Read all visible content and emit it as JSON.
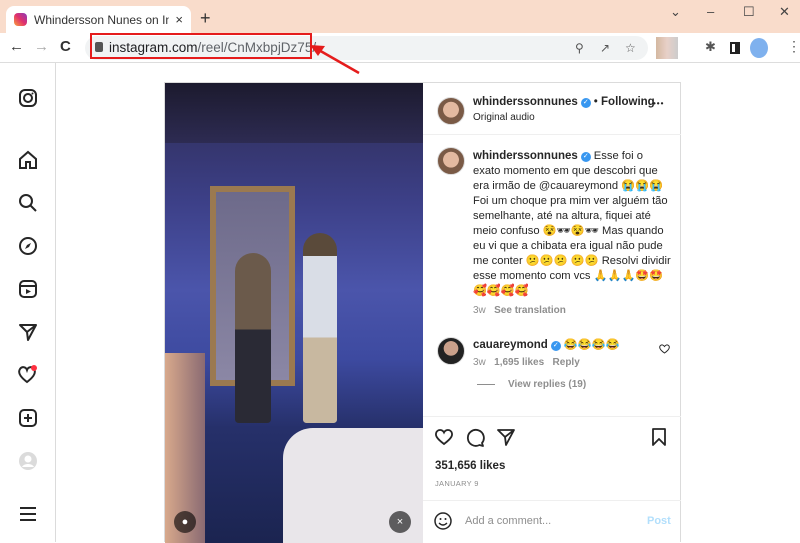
{
  "browser": {
    "tab_title": "Whindersson Nunes on Instag",
    "tab_close": "×",
    "new_tab": "+",
    "url_host": "instagram.com",
    "url_path": "/reel/CnMxbpjDz75/",
    "window_controls": [
      "⌄",
      "–",
      "☐",
      "✕"
    ],
    "nav": [
      "←",
      "→",
      "C"
    ]
  },
  "sidebar": {
    "items": [
      "instagram-logo",
      "home",
      "search",
      "explore",
      "reels",
      "messages",
      "notifications",
      "create",
      "profile",
      "more"
    ]
  },
  "post": {
    "username": "whinderssonnunes",
    "follow_sep": "•",
    "follow_label": "Following",
    "audio": "Original audio",
    "more": "•••",
    "caption_user": "whinderssonnunes",
    "caption": "Esse foi o exato momento em que descobri que era irmão de @cauareymond 😭😭😭 Foi um choque pra mim ver alguém tão semelhante, até na altura, fiquei até meio confuso 😵🕶😵🕶 Mas quando eu vi que a chibata era igual não pude me conter 😕😕😕 😕😕 Resolvi dividir esse momento com vcs 🙏🙏🙏🤩🤩🥰🥰🥰🥰",
    "caption_time": "3w",
    "see_translation": "See translation",
    "comment": {
      "user": "cauareymond",
      "text": "😂😂😂😂",
      "time": "3w",
      "likes": "1,695 likes",
      "reply": "Reply",
      "view_replies": "View replies (19)"
    },
    "likes": "351,656 likes",
    "date": "JANUARY 9",
    "comment_placeholder": "Add a comment...",
    "post_button": "Post"
  },
  "colors": {
    "accent": "#3897f0",
    "annotation": "#e51c1c",
    "tabbar": "#f9dccb"
  }
}
